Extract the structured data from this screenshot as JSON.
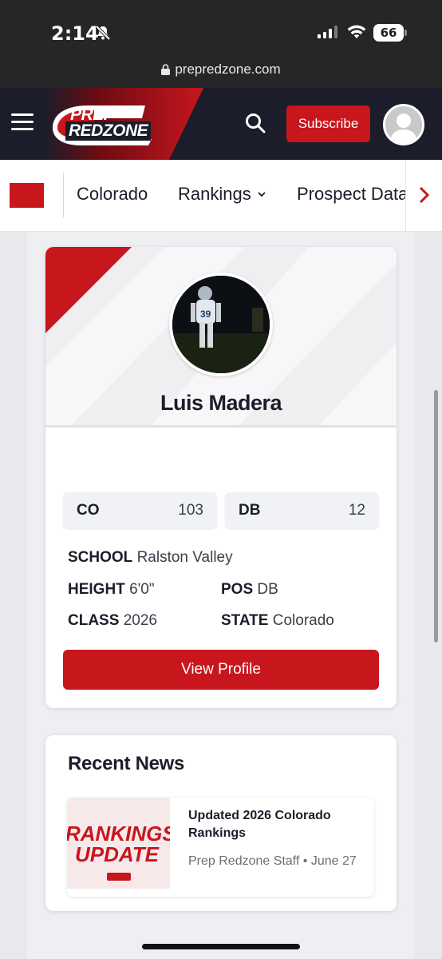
{
  "status_bar": {
    "time": "2:14",
    "battery": "66"
  },
  "browser": {
    "url": "prepredzone.com"
  },
  "header": {
    "logo_line1": "PREP",
    "logo_line2": "REDZONE",
    "subscribe_label": "Subscribe",
    "brand_color": "#c8161d",
    "dark_color": "#1b1d2a"
  },
  "nav": {
    "items": [
      {
        "label": "Colorado"
      },
      {
        "label": "Rankings"
      },
      {
        "label": "Prospect Data"
      }
    ]
  },
  "player": {
    "name": "Luis Madera",
    "jersey": "39",
    "ranks": [
      {
        "label": "CO",
        "value": "103"
      },
      {
        "label": "DB",
        "value": "12"
      }
    ],
    "school_label": "SCHOOL",
    "school": "Ralston Valley",
    "height_label": "HEIGHT",
    "height": "6'0\"",
    "pos_label": "POS",
    "pos": "DB",
    "class_label": "CLASS",
    "class": "2026",
    "state_label": "STATE",
    "state": "Colorado",
    "view_profile_label": "View Profile"
  },
  "news": {
    "title": "Recent News",
    "items": [
      {
        "thumb_line1": "RANKINGS",
        "thumb_line2": "UPDATE",
        "headline": "Updated 2026 Colorado Rankings",
        "meta": "Prep Redzone Staff • June 27"
      }
    ]
  }
}
